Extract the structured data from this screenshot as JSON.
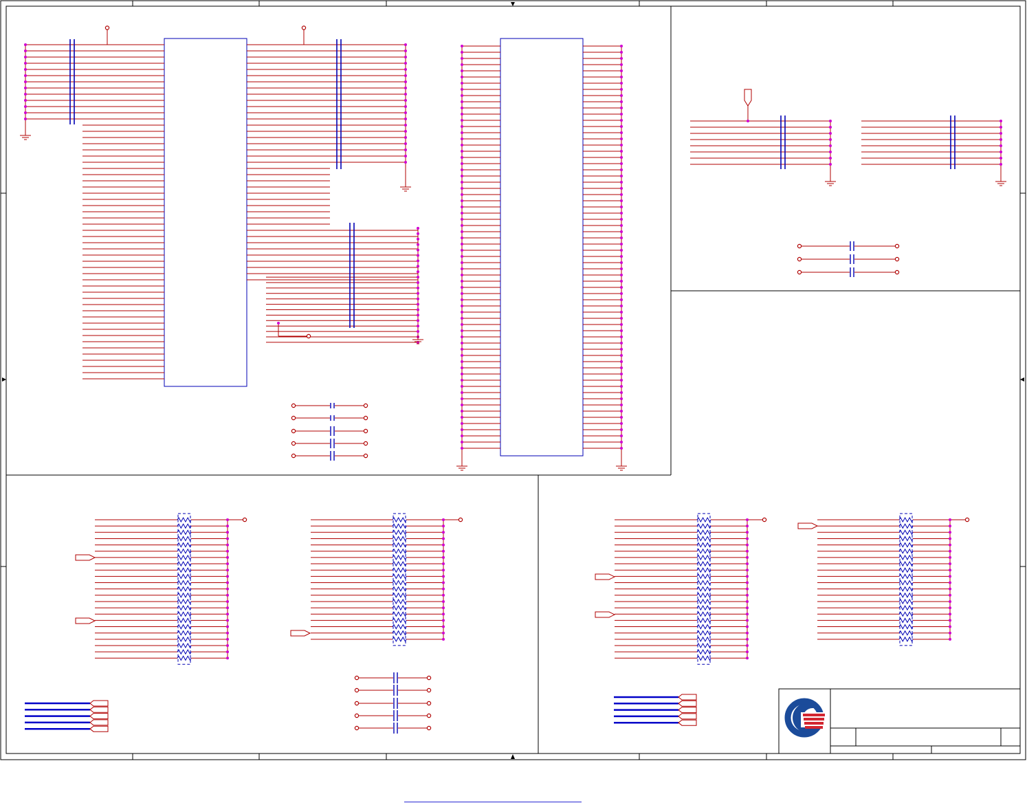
{
  "schematic": {
    "frame_zones": {
      "columns": 8,
      "rows": 4
    },
    "colors": {
      "frame": "#000000",
      "wire": "#b00000",
      "component": "#0000b4",
      "pin_dot": "#d000d0",
      "bus": "#0000c8",
      "logo_blue": "#1b4b9a",
      "logo_red": "#d22630"
    },
    "blocks": [
      {
        "id": "connector-1",
        "pins": 55
      },
      {
        "id": "connector-2",
        "pins": 66
      }
    ],
    "resistor_arrays": 4,
    "bypass_capacitors": 13,
    "icons": [
      "ground-icon",
      "power-icon",
      "port-arrow-icon",
      "company-logo-icon"
    ],
    "bottom_link": {
      "text": ""
    }
  }
}
